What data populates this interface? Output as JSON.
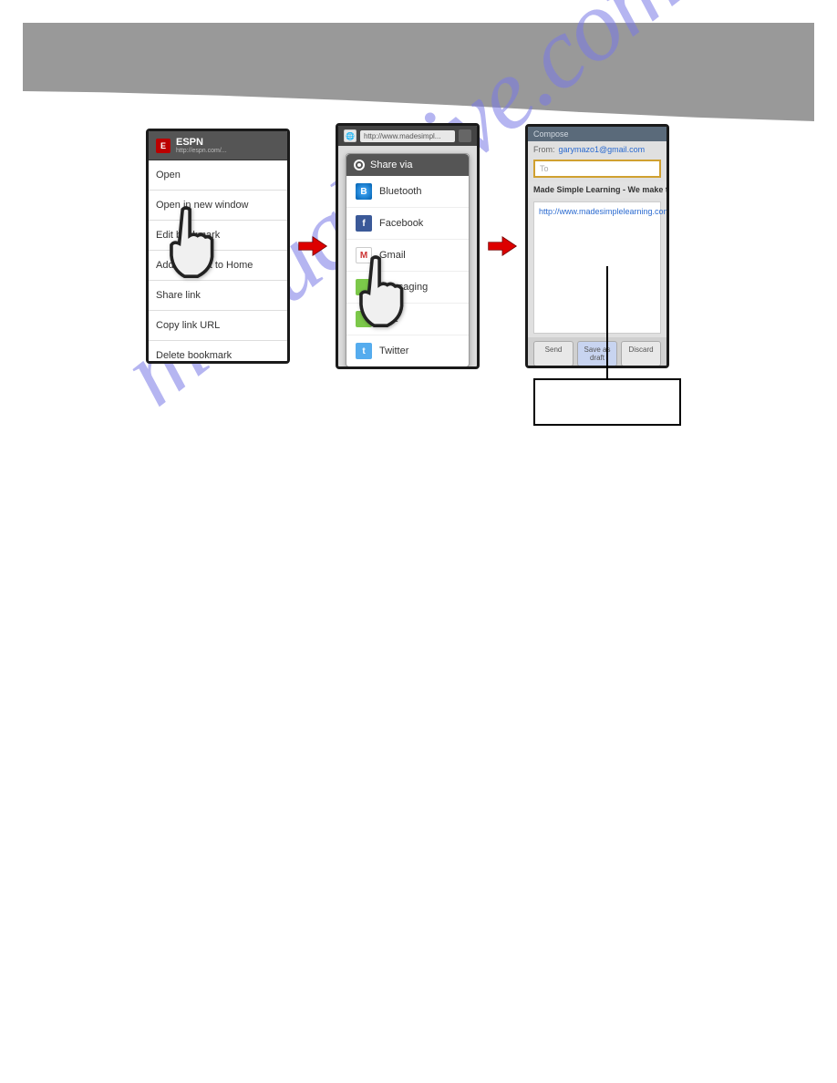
{
  "watermark": "manualshive.com",
  "phone1": {
    "badge": "E",
    "title": "ESPN",
    "subtitle": "http://espn.com/...",
    "menu": [
      "Open",
      "Open in new window",
      "Edit bookmark",
      "Add shortcut to Home",
      "Share link",
      "Copy link URL",
      "Delete bookmark"
    ]
  },
  "phone2": {
    "address": "http://www.madesimpl...",
    "share_title": "Share via",
    "items": [
      {
        "label": "Bluetooth",
        "cls": "bt",
        "ic": "B"
      },
      {
        "label": "Facebook",
        "cls": "fb",
        "ic": "f"
      },
      {
        "label": "Gmail",
        "cls": "gm",
        "ic": "M"
      },
      {
        "label": "Messaging",
        "cls": "ms",
        "ic": ""
      },
      {
        "label": "Text",
        "cls": "ms",
        "ic": ""
      },
      {
        "label": "Twitter",
        "cls": "tw",
        "ic": "t"
      }
    ]
  },
  "phone3": {
    "compose": "Compose",
    "from_label": "From:",
    "from_email": "garymazo1@gmail.com",
    "to_placeholder": "To",
    "subject": "Made Simple Learning - We make te",
    "body": "http://www.madesimplelearning.com/index.shtml",
    "buttons": {
      "send": "Send",
      "draft": "Save as draft",
      "discard": "Discard"
    }
  }
}
